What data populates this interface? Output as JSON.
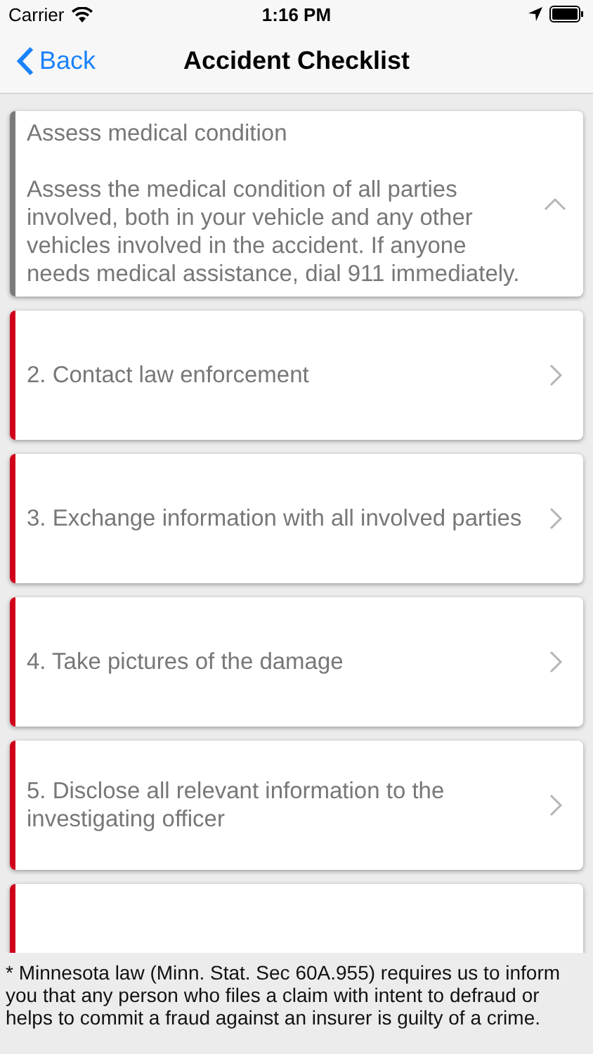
{
  "status_bar": {
    "carrier": "Carrier",
    "time": "1:16 PM"
  },
  "nav": {
    "back": "Back",
    "title": "Accident Checklist"
  },
  "steps": [
    {
      "title": "Assess medical condition",
      "body": "Assess the medical condition of all parties involved, both in your vehicle and any other vehicles involved in the accident. If anyone needs medical assistance, dial 911 immediately.",
      "expanded": true,
      "color": "#7b7b7b"
    },
    {
      "title": "2. Contact law enforcement",
      "expanded": false,
      "color": "#d0021b"
    },
    {
      "title": "3. Exchange information with all involved parties",
      "expanded": false,
      "color": "#d0021b"
    },
    {
      "title": "4. Take pictures of the damage",
      "expanded": false,
      "color": "#d0021b"
    },
    {
      "title": "5. Disclose all relevant information to the investigating officer",
      "expanded": false,
      "color": "#d0021b"
    }
  ],
  "footer": "* Minnesota law (Minn. Stat. Sec 60A.955) requires us to inform you that any person who files a claim with intent to defraud or helps to commit a fraud against an insurer is guilty of a crime."
}
